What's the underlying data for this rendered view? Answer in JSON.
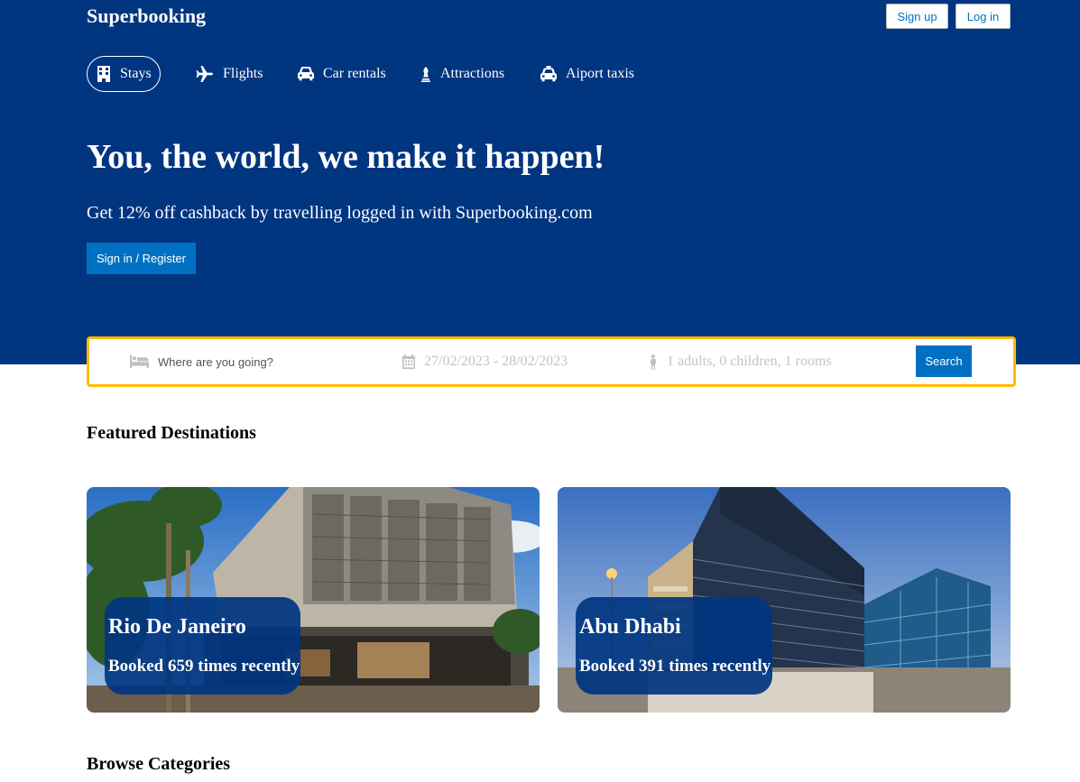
{
  "header": {
    "brand": "Superbooking",
    "signup_label": "Sign up",
    "login_label": "Log in"
  },
  "nav": {
    "items": [
      {
        "label": "Stays",
        "icon": "building-icon",
        "active": true
      },
      {
        "label": "Flights",
        "icon": "plane-icon",
        "active": false
      },
      {
        "label": "Car rentals",
        "icon": "car-icon",
        "active": false
      },
      {
        "label": "Attractions",
        "icon": "chess-piece-icon",
        "active": false
      },
      {
        "label": "Aiport taxis",
        "icon": "taxi-icon",
        "active": false
      }
    ]
  },
  "hero": {
    "title": "You, the world, we make it happen!",
    "subtitle": "Get 12% off cashback by travelling logged in with Superbooking.com",
    "register_label": "Sign in / Register"
  },
  "search": {
    "destination_placeholder": "Where are you going?",
    "dates": "27/02/2023 - 28/02/2023",
    "guests": "1 adults, 0 children, 1 rooms",
    "button_label": "Search",
    "icons": [
      "bed-icon",
      "calendar-icon",
      "person-icon"
    ]
  },
  "featured": {
    "title": "Featured Destinations",
    "cards": [
      {
        "name": "Rio De Janeiro",
        "subtitle": "Booked 659 times recently"
      },
      {
        "name": "Abu Dhabi",
        "subtitle": "Booked 391 times recently"
      }
    ]
  },
  "browse": {
    "title": "Browse Categories"
  },
  "colors": {
    "brand_blue": "#003580",
    "action_blue": "#0071c2",
    "search_border": "#febb02"
  }
}
